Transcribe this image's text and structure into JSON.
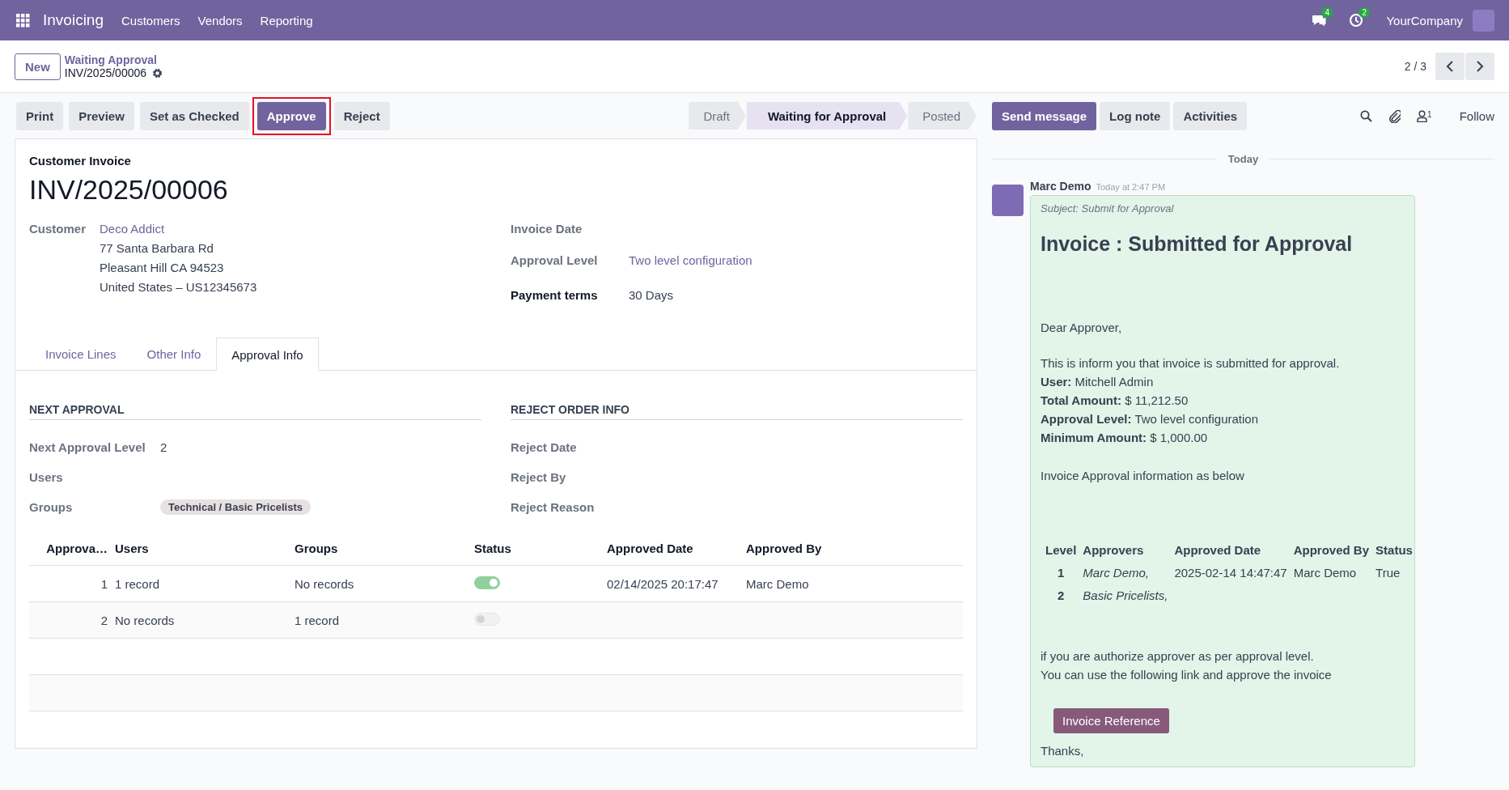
{
  "navbar": {
    "app_name": "Invoicing",
    "menus": [
      "Customers",
      "Vendors",
      "Reporting"
    ],
    "messages_badge": "4",
    "activities_badge": "2",
    "company": "YourCompany"
  },
  "control_panel": {
    "new_button": "New",
    "breadcrumb": "Waiting Approval",
    "record": "INV/2025/00006",
    "pager": "2 / 3"
  },
  "actions": [
    {
      "label": "Print",
      "primary": false,
      "highlighted": false
    },
    {
      "label": "Preview",
      "primary": false,
      "highlighted": false
    },
    {
      "label": "Set as Checked",
      "primary": false,
      "highlighted": false
    },
    {
      "label": "Approve",
      "primary": true,
      "highlighted": true
    },
    {
      "label": "Reject",
      "primary": false,
      "highlighted": false
    }
  ],
  "statusbar": [
    {
      "label": "Draft",
      "selected": false
    },
    {
      "label": "Waiting for Approval",
      "selected": true
    },
    {
      "label": "Posted",
      "selected": false
    }
  ],
  "form": {
    "type_label": "Customer Invoice",
    "number": "INV/2025/00006",
    "customer": {
      "label": "Customer",
      "name": "Deco Addict",
      "address": [
        "77 Santa Barbara Rd",
        "Pleasant Hill CA 94523",
        "United States – US12345673"
      ]
    },
    "right_fields": [
      {
        "label": "Invoice Date",
        "strong": false
      },
      {
        "label": "Approval Level",
        "value": "Two level configuration",
        "kind": "link",
        "strong": false
      },
      {
        "label": "Payment terms",
        "value": "30 Days",
        "kind": "text",
        "strong": true
      }
    ],
    "tabs": [
      {
        "label": "Invoice Lines",
        "selected": false
      },
      {
        "label": "Other Info",
        "selected": false
      },
      {
        "label": "Approval Info",
        "selected": true
      }
    ],
    "next_approval": {
      "title": "NEXT APPROVAL",
      "fields": [
        {
          "label": "Next Approval Level",
          "value": "2",
          "kind": "text"
        },
        {
          "label": "Users"
        },
        {
          "label": "Groups",
          "value": "Technical / Basic Pricelists",
          "kind": "tag"
        }
      ]
    },
    "reject_info": {
      "title": "REJECT ORDER INFO",
      "fields": [
        {
          "label": "Reject Date"
        },
        {
          "label": "Reject By"
        },
        {
          "label": "Reject Reason"
        }
      ]
    },
    "approval_table": {
      "columns": [
        "Approva…",
        "Users",
        "Groups",
        "Status",
        "Approved Date",
        "Approved By"
      ],
      "rows": [
        {
          "level": "1",
          "users": "1 record",
          "groups": "No records",
          "status_on": true,
          "approved_date": "02/14/2025 20:17:47",
          "approved_by": "Marc Demo"
        },
        {
          "level": "2",
          "users": "No records",
          "groups": "1 record",
          "status_on": false
        }
      ]
    }
  },
  "chatter": {
    "buttons": [
      {
        "label": "Send message",
        "primary": true
      },
      {
        "label": "Log note",
        "primary": false
      },
      {
        "label": "Activities",
        "primary": false
      }
    ],
    "followers_count": "1",
    "follow": "Follow",
    "date_divider": "Today",
    "message": {
      "author": "Marc Demo",
      "time": "Today at 2:47 PM",
      "subject": "Subject: Submit for Approval",
      "heading": "Invoice : Submitted for Approval",
      "greeting": "Dear Approver,",
      "intro": [
        "This is inform you that invoice is submitted for approval.",
        "**User:** Mitchell Admin",
        "**Total Amount:** $ 11,212.50",
        "**Approval Level:** Two level configuration",
        "**Minimum Amount:** $ 1,000.00"
      ],
      "table_intro": "Invoice Approval information as below",
      "table": {
        "columns": [
          "Level",
          "Approvers",
          "Approved Date",
          "Approved By",
          "Status"
        ],
        "rows": [
          {
            "level": "1",
            "approvers": "Marc Demo,",
            "approved_date": "2025-02-14 14:47:47",
            "approved_by": "Marc Demo",
            "status": "True"
          },
          {
            "level": "2",
            "approvers": "Basic Pricelists,"
          }
        ]
      },
      "closing": [
        "if you are authorize approver as per approval level.",
        "You can use the following link and approve the invoice"
      ],
      "button": "Invoice Reference",
      "sign_off": "Thanks,"
    }
  }
}
